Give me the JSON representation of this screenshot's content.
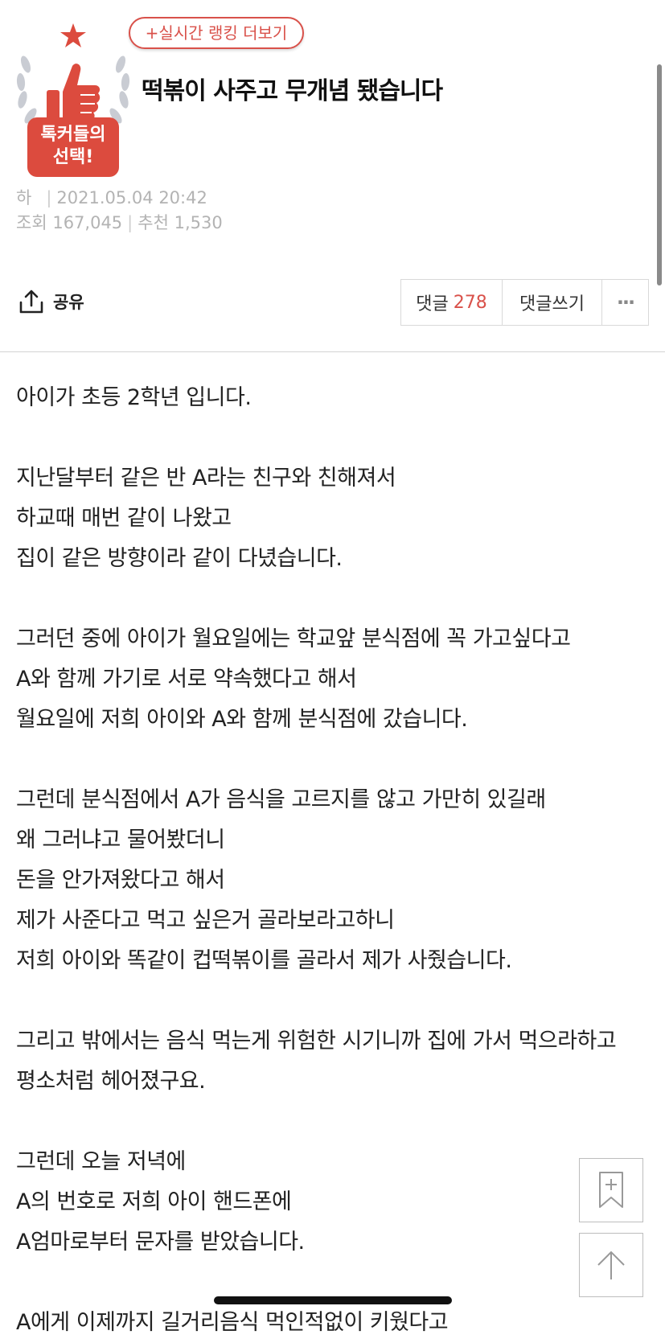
{
  "ranking_button": "+실시간 랭킹 더보기",
  "badge": {
    "line1": "톡커들의",
    "line2": "선택!"
  },
  "post": {
    "title": "떡볶이 사주고 무개념 됐습니다",
    "author": "하",
    "date": "2021.05.04 20:42",
    "views_label": "조회",
    "views": "167,045",
    "recommend_label": "추천",
    "recommend": "1,530"
  },
  "share_label": "공유",
  "actions": {
    "comments_label": "댓글",
    "comments_count": "278",
    "write_label": "댓글쓰기",
    "more_label": "···"
  },
  "body_lines": [
    "아이가 초등 2학년 입니다.",
    "",
    "지난달부터 같은 반 A라는 친구와 친해져서",
    "하교때 매번 같이 나왔고",
    "집이 같은 방향이라 같이 다녔습니다.",
    "",
    "그러던 중에 아이가 월요일에는 학교앞 분식점에 꼭 가고싶다고",
    "A와 함께 가기로 서로 약속했다고 해서",
    "월요일에 저희 아이와 A와 함께 분식점에 갔습니다.",
    "",
    "그런데 분식점에서 A가 음식을 고르지를 않고 가만히 있길래",
    "왜 그러냐고 물어봤더니",
    "돈을 안가져왔다고 해서",
    "제가 사준다고 먹고 싶은거 골라보라고하니",
    "저희 아이와 똑같이 컵떡볶이를 골라서 제가 사줬습니다.",
    "",
    "그리고 밖에서는 음식 먹는게 위험한 시기니까 집에 가서 먹으라하고",
    "평소처럼 헤어졌구요.",
    "",
    "그런데 오늘 저녁에",
    "A의 번호로 저희 아이 핸드폰에",
    "A엄마로부터 문자를 받았습니다.",
    "",
    "A에게 이제까지 길거리음식 먹인적없이 키웠다고"
  ],
  "colors": {
    "accent": "#d9514a",
    "badge": "#dc4b3e"
  }
}
